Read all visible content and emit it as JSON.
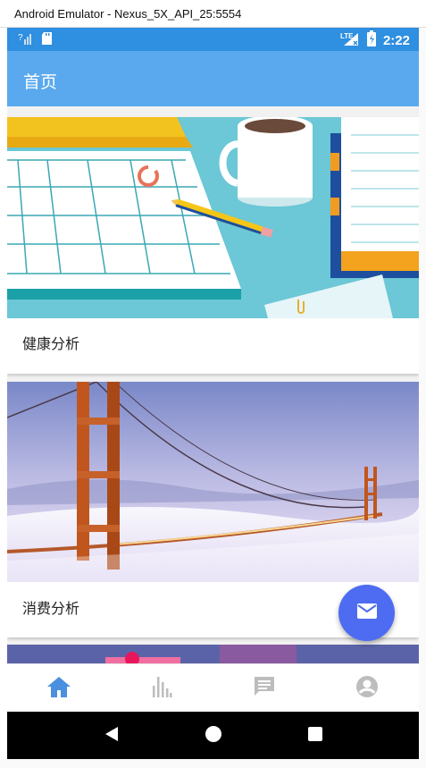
{
  "window": {
    "title": "Android Emulator - Nexus_5X_API_25:5554"
  },
  "status_bar": {
    "time": "2:22",
    "network": "LTE"
  },
  "app_bar": {
    "title": "首页"
  },
  "cards": [
    {
      "label": "健康分析",
      "image": "desk-calendar-illustration"
    },
    {
      "label": "消费分析",
      "image": "golden-gate-bridge-photo"
    },
    {
      "label": "",
      "image": "pink-illustration-partial"
    }
  ],
  "fab": {
    "icon": "mail-icon"
  },
  "bottom_nav": {
    "items": [
      {
        "icon": "home-icon",
        "active": true
      },
      {
        "icon": "bar-chart-icon",
        "active": false
      },
      {
        "icon": "message-icon",
        "active": false
      },
      {
        "icon": "account-icon",
        "active": false
      }
    ]
  },
  "colors": {
    "status_bar": "#2f8fe0",
    "app_bar": "#5aa9ee",
    "fab": "#4d6cf2",
    "nav_active": "#4a8fe0",
    "nav_inactive": "#bdbdbd"
  }
}
